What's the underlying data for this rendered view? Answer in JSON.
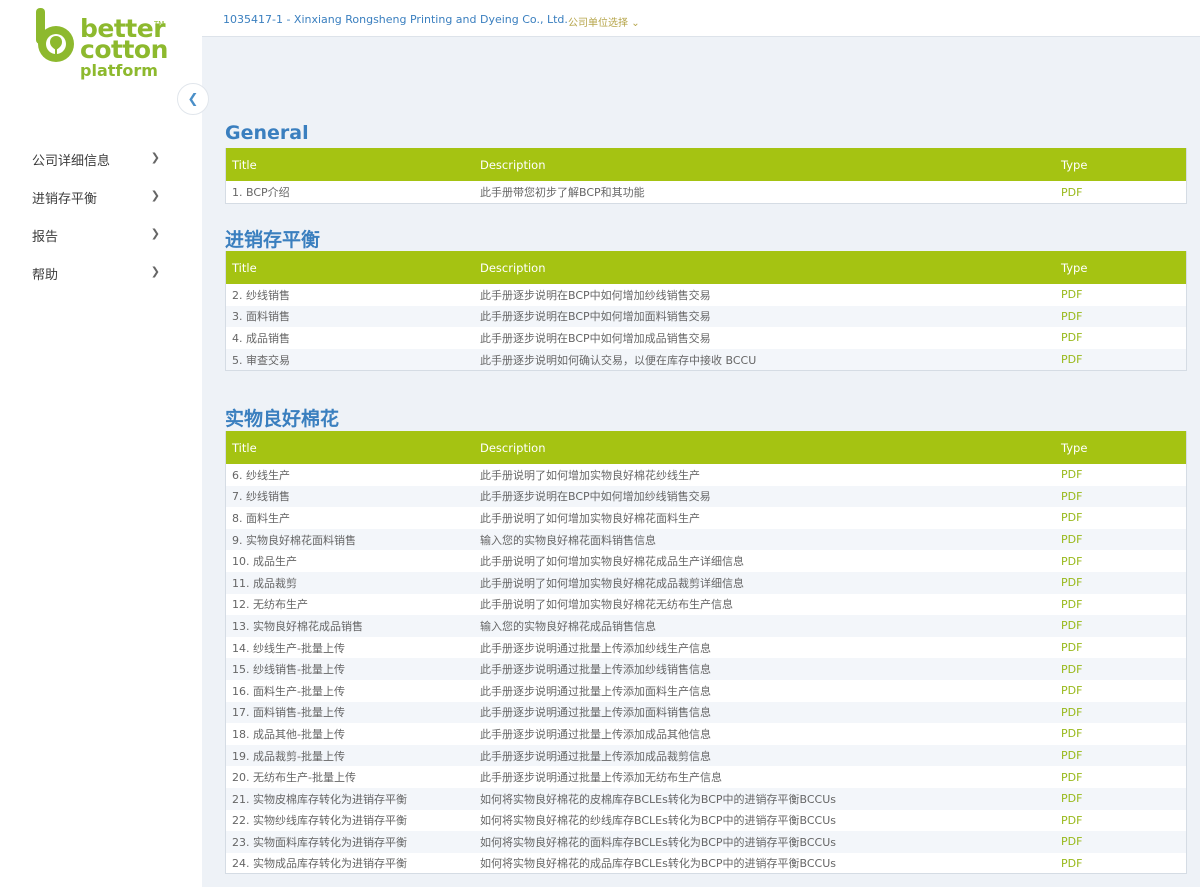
{
  "brand": {
    "line1": "better",
    "line2": "cotton",
    "line3": "platform",
    "tm": "TM",
    "accent": "#8db92e"
  },
  "header": {
    "company": "1035417-1 - Xinxiang Rongsheng Printing and Dyeing Co., Ltd.",
    "selector": "公司单位选择"
  },
  "sidebar": {
    "collapse_icon": "chevron-left-icon",
    "items": [
      {
        "label": "公司详细信息"
      },
      {
        "label": "进销存平衡"
      },
      {
        "label": "报告"
      },
      {
        "label": "帮助"
      }
    ]
  },
  "table_columns": {
    "title": "Title",
    "description": "Description",
    "type": "Type"
  },
  "sections": [
    {
      "title": "General",
      "rows": [
        {
          "title": "1. BCP介绍",
          "description": "此手册带您初步了解BCP和其功能",
          "type": "PDF"
        }
      ]
    },
    {
      "title": "进销存平衡",
      "rows": [
        {
          "title": "2. 纱线销售",
          "description": "此手册逐步说明在BCP中如何增加纱线销售交易",
          "type": "PDF"
        },
        {
          "title": "3. 面料销售",
          "description": "此手册逐步说明在BCP中如何增加面料销售交易",
          "type": "PDF"
        },
        {
          "title": "4. 成品销售",
          "description": "此手册逐步说明在BCP中如何增加成品销售交易",
          "type": "PDF"
        },
        {
          "title": "5. 审查交易",
          "description": "此手册逐步说明如何确认交易，以便在库存中接收 BCCU",
          "type": "PDF"
        }
      ]
    },
    {
      "title": "实物良好棉花",
      "rows": [
        {
          "title": "6. 纱线生产",
          "description": "此手册说明了如何增加实物良好棉花纱线生产",
          "type": "PDF"
        },
        {
          "title": "7. 纱线销售",
          "description": "此手册逐步说明在BCP中如何增加纱线销售交易",
          "type": "PDF"
        },
        {
          "title": "8. 面料生产",
          "description": "此手册说明了如何增加实物良好棉花面料生产",
          "type": "PDF"
        },
        {
          "title": "9. 实物良好棉花面料销售",
          "description": "输入您的实物良好棉花面料销售信息",
          "type": "PDF"
        },
        {
          "title": "10. 成品生产",
          "description": "此手册说明了如何增加实物良好棉花成品生产详细信息",
          "type": "PDF"
        },
        {
          "title": "11. 成品裁剪",
          "description": "此手册说明了如何增加实物良好棉花成品裁剪详细信息",
          "type": "PDF"
        },
        {
          "title": "12. 无纺布生产",
          "description": "此手册说明了如何增加实物良好棉花无纺布生产信息",
          "type": "PDF"
        },
        {
          "title": "13. 实物良好棉花成品销售",
          "description": "输入您的实物良好棉花成品销售信息",
          "type": "PDF"
        },
        {
          "title": "14. 纱线生产-批量上传",
          "description": "此手册逐步说明通过批量上传添加纱线生产信息",
          "type": "PDF"
        },
        {
          "title": "15. 纱线销售-批量上传",
          "description": "此手册逐步说明通过批量上传添加纱线销售信息",
          "type": "PDF"
        },
        {
          "title": "16. 面料生产-批量上传",
          "description": "此手册逐步说明通过批量上传添加面料生产信息",
          "type": "PDF"
        },
        {
          "title": "17. 面料销售-批量上传",
          "description": "此手册逐步说明通过批量上传添加面料销售信息",
          "type": "PDF"
        },
        {
          "title": "18. 成品其他-批量上传",
          "description": "此手册逐步说明通过批量上传添加成品其他信息",
          "type": "PDF"
        },
        {
          "title": "19. 成品裁剪-批量上传",
          "description": "此手册逐步说明通过批量上传添加成品裁剪信息",
          "type": "PDF"
        },
        {
          "title": "20. 无纺布生产-批量上传",
          "description": "此手册逐步说明通过批量上传添加无纺布生产信息",
          "type": "PDF"
        },
        {
          "title": "21. 实物皮棉库存转化为进销存平衡",
          "description": "如何将实物良好棉花的皮棉库存BCLEs转化为BCP中的进销存平衡BCCUs",
          "type": "PDF"
        },
        {
          "title": "22. 实物纱线库存转化为进销存平衡",
          "description": "如何将实物良好棉花的纱线库存BCLEs转化为BCP中的进销存平衡BCCUs",
          "type": "PDF"
        },
        {
          "title": "23. 实物面料库存转化为进销存平衡",
          "description": "如何将实物良好棉花的面料库存BCLEs转化为BCP中的进销存平衡BCCUs",
          "type": "PDF"
        },
        {
          "title": "24. 实物成品库存转化为进销存平衡",
          "description": "如何将实物良好棉花的成品库存BCLEs转化为BCP中的进销存平衡BCCUs",
          "type": "PDF"
        }
      ]
    }
  ]
}
